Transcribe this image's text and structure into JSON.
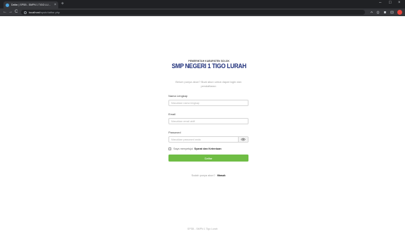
{
  "browser": {
    "tab_title": "Daftar | SPSB - SMPN 1 TIGO LU...",
    "tab_close": "×",
    "new_tab": "+",
    "url_host": "localhost",
    "url_path": "/spsb/daftar.php",
    "window_controls": {
      "minimize": "–",
      "maximize": "□",
      "close": "×"
    },
    "nav": {
      "back": "←",
      "forward": "→",
      "reload": "C"
    }
  },
  "header": {
    "subtitle": "PEMERINTAH KABUPATEN SOLOK",
    "school_name": "SMP NEGERI 1 TIGO LURAH"
  },
  "form": {
    "intro": "Belum punya akun? Buat akun untuk dapat login dan pendaftaran",
    "full_name_label": "Nama Lengkap",
    "full_name_placeholder": "Masukkan nama lengkap",
    "email_label": "Email",
    "email_placeholder": "Masukkan email aktif",
    "password_label": "Password",
    "password_placeholder": "Masukkan password anda",
    "terms_text": "Saya menyetujui",
    "terms_link": "Syarat dan Ketentuan",
    "submit_label": "Daftar",
    "login_prompt": "Sudah punya akun?",
    "login_link": "Masuk"
  },
  "footer": {
    "text": "SPSB - SMPN 1 Tigo Lurah"
  },
  "colors": {
    "accent": "#6fbd45",
    "brand": "#1e2f7a",
    "chrome": "#202124"
  }
}
